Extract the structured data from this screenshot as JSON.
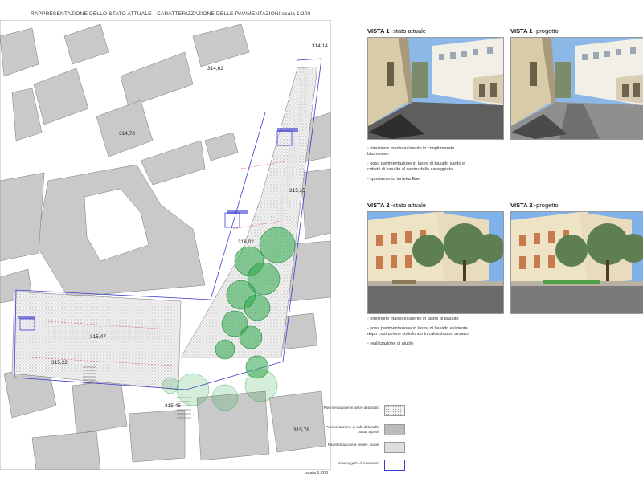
{
  "sheet": {
    "title": "RAPPRESENTAZIONE DELLO STATO ATTUALE - CARATTERIZZAZIONE DELLE PAVIMENTAZIONI  scala 1:200",
    "scale_label": "scala 1:200"
  },
  "elevations": [
    {
      "id": "e1",
      "label": "314,14"
    },
    {
      "id": "e2",
      "label": "314,62"
    },
    {
      "id": "e3",
      "label": "314,73"
    },
    {
      "id": "e4",
      "label": "315,15"
    },
    {
      "id": "e5",
      "label": "316,02"
    },
    {
      "id": "e6",
      "label": "315,47"
    },
    {
      "id": "e7",
      "label": "315,22"
    },
    {
      "id": "e8",
      "label": "315,45"
    },
    {
      "id": "e9",
      "label": "315,78"
    }
  ],
  "views": {
    "v1_current": {
      "title": "VISTA 1",
      "subtitle": "-stato attuale"
    },
    "v1_project": {
      "title": "VISTA 1",
      "subtitle": "-progetto"
    },
    "v2_current": {
      "title": "VISTA 2",
      "subtitle": "-stato attuale"
    },
    "v2_project": {
      "title": "VISTA 2",
      "subtitle": "-progetto"
    }
  },
  "notes1": [
    "- rimozione manto esistente in conglomerato bituminoso",
    "- posa pavimentazione in lastre di basalto sardo e cubetti di basalto al centro della carreggiata",
    "- spostamento torretta Enel"
  ],
  "notes2": [
    "- rimozione manto esistente in lastre di basalto",
    "- posa pavimentazione in lastre di basalto esistente dopo costruzione sottofondo in calcestruzzo armato",
    "- realizzazione di aiuole"
  ],
  "legend": [
    {
      "label": "Pavimentazione in lastre di basalto",
      "pattern": "dots"
    },
    {
      "label": "Pavimentazione in cubi di basalto posati a pavé",
      "pattern": "dark"
    },
    {
      "label": "Pavimentazione a verde - aiuole",
      "pattern": "light"
    },
    {
      "label": "aree oggetto di intervento",
      "pattern": "outline"
    }
  ],
  "colors": {
    "intervention_outline": "#3c3cd2",
    "tree_green": "#2ea84a",
    "building_gray": "#c9c9c9",
    "dimension_red": "#e03030"
  }
}
